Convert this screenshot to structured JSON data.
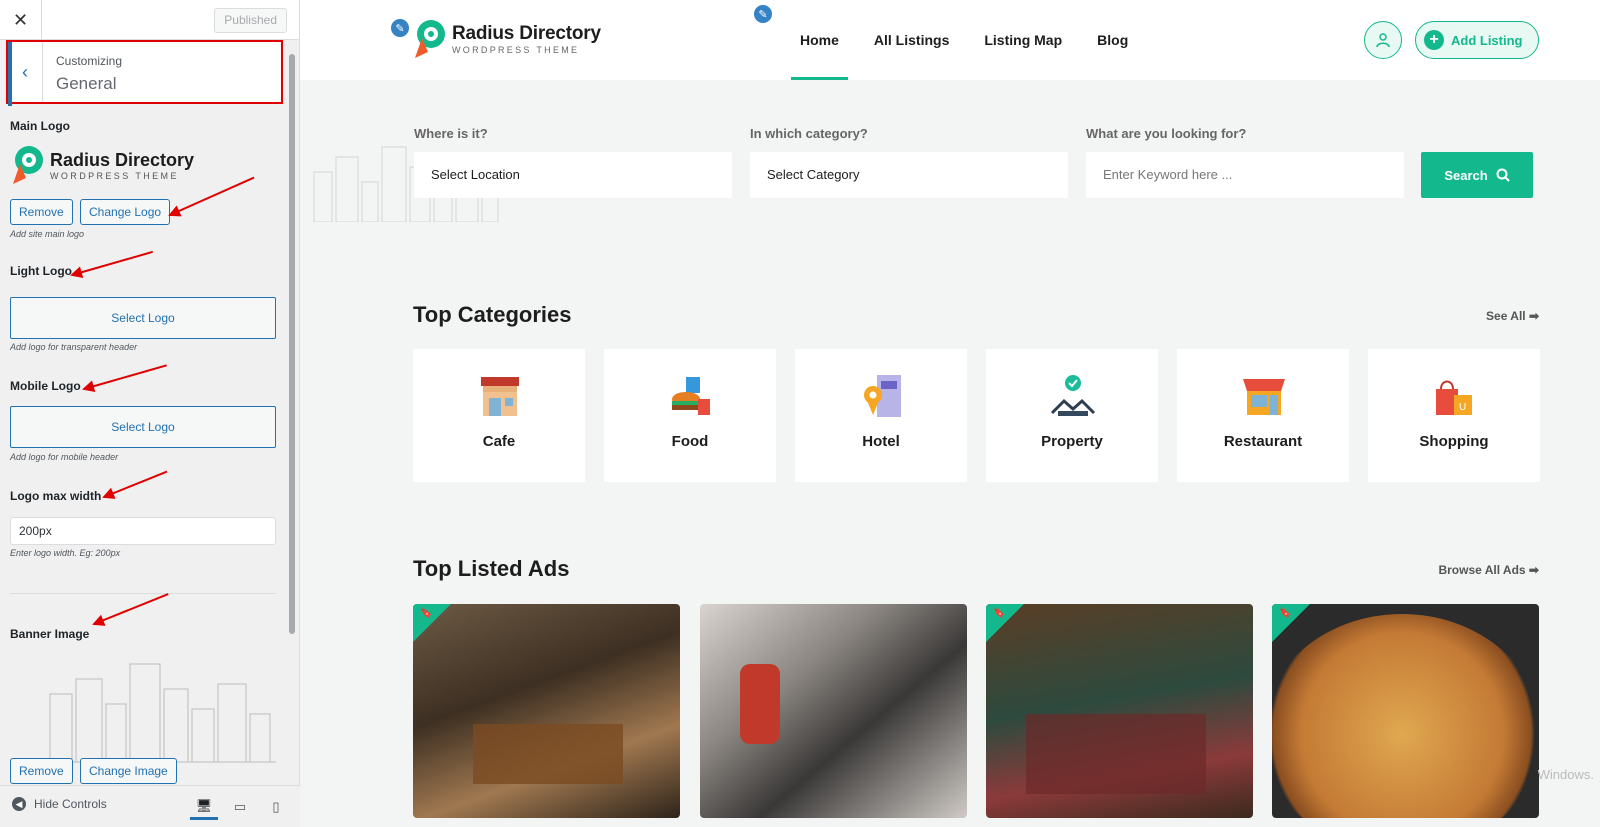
{
  "sidebar": {
    "close_icon": "close-icon",
    "published_label": "Published",
    "customizing_label": "Customizing",
    "section_title": "General",
    "main_logo": {
      "label": "Main Logo",
      "logo_title": "Radius Directory",
      "logo_subtitle": "WORDPRESS THEME",
      "remove_label": "Remove",
      "change_label": "Change Logo",
      "description": "Add site main logo"
    },
    "light_logo": {
      "label": "Light Logo",
      "button_label": "Select Logo",
      "description": "Add logo for transparent header"
    },
    "mobile_logo": {
      "label": "Mobile Logo",
      "button_label": "Select Logo",
      "description": "Add logo for mobile header"
    },
    "logo_max_width": {
      "label": "Logo max width",
      "value": "200px",
      "description": "Enter logo width. Eg: 200px"
    },
    "banner_image": {
      "label": "Banner Image",
      "remove_label": "Remove",
      "change_label": "Change Image"
    },
    "footer": {
      "hide_controls": "Hide Controls"
    }
  },
  "site": {
    "logo_title": "Radius Directory",
    "logo_subtitle": "WORDPRESS THEME",
    "nav": [
      {
        "label": "Home",
        "active": true
      },
      {
        "label": "All Listings",
        "active": false
      },
      {
        "label": "Listing Map",
        "active": false
      },
      {
        "label": "Blog",
        "active": false
      }
    ],
    "add_listing": "Add Listing",
    "accent_color": "#14b88d"
  },
  "search": {
    "location_label": "Where is it?",
    "location_value": "Select Location",
    "category_label": "In which category?",
    "category_value": "Select Category",
    "keyword_label": "What are you looking for?",
    "keyword_placeholder": "Enter Keyword here ...",
    "button_label": "Search"
  },
  "categories": {
    "title": "Top Categories",
    "see_all": "See All ➡",
    "items": [
      {
        "label": "Cafe",
        "icon": "cafe-icon"
      },
      {
        "label": "Food",
        "icon": "food-icon"
      },
      {
        "label": "Hotel",
        "icon": "hotel-icon"
      },
      {
        "label": "Property",
        "icon": "property-icon"
      },
      {
        "label": "Restaurant",
        "icon": "restaurant-icon"
      },
      {
        "label": "Shopping",
        "icon": "shopping-icon"
      }
    ]
  },
  "ads": {
    "title": "Top Listed Ads",
    "browse_all": "Browse All Ads ➡",
    "items": [
      {
        "image": "cafe-interior-photo"
      },
      {
        "image": "coffee-bar-photo"
      },
      {
        "image": "restaurant-dining-photo"
      },
      {
        "image": "pizza-photo"
      }
    ]
  },
  "watermark": "Windows."
}
